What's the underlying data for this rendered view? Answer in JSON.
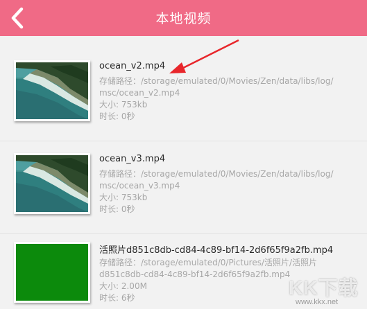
{
  "header": {
    "title": "本地视频",
    "back_icon": "chevron-left-icon",
    "bg_color": "#f06a86"
  },
  "videos": [
    {
      "file_name": "ocean_v2.mp4",
      "path_line1": "存储路径：/storage/emulated/0/Movies/Zen/data/libs/log/",
      "path_line2": "msc/ocean_v2.mp4",
      "size": "大小: 753kb",
      "duration": "时长: 0秒",
      "thumbnail": "ocean-coast-thumbnail"
    },
    {
      "file_name": "ocean_v3.mp4",
      "path_line1": "存储路径：/storage/emulated/0/Movies/Zen/data/libs/log/",
      "path_line2": "msc/ocean_v3.mp4",
      "size": "大小: 753kb",
      "duration": "时长: 0秒",
      "thumbnail": "ocean-coast-thumbnail"
    },
    {
      "file_name": "活照片d851c8db-cd84-4c89-bf14-2d6f65f9a2fb.mp4",
      "path_line1": "存储路径：/storage/emulated/0/Pictures/活照片/活照片",
      "path_line2": "d851c8db-cd84-4c89-bf14-2d6f65f9a2fb.mp4",
      "size": "大小: 2.00M",
      "duration": "时长: 6秒",
      "thumbnail": "green-placeholder-thumbnail"
    }
  ],
  "annotation": {
    "arrow_color": "#e8262b"
  },
  "watermark": {
    "logo_text": "KK下载",
    "url": "www.kkx.net"
  }
}
